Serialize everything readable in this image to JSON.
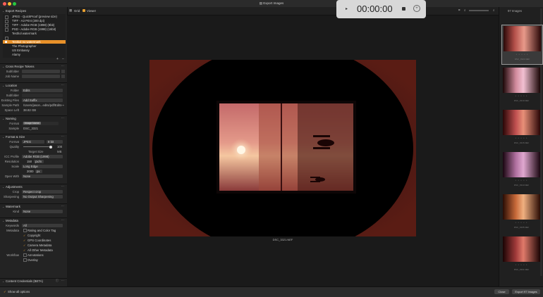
{
  "window": {
    "title": "Export Images"
  },
  "toolbar": {
    "grid_label": "Grid",
    "viewer_label": "Viewer"
  },
  "film_count": "97 Images",
  "recorder": {
    "time": "00:00:00"
  },
  "sidebar": {
    "export_recipes": {
      "title": "Export Recipes",
      "items": [
        "JPEG - QuickProof (preview size)",
        "TIFF - A3 Print (300 dpi)",
        "TIFF - Adobe RGB (1998) (8bit)",
        "PSD - Adobe RGB (1998) (16bit)",
        "Testhol watermark",
        "Testkol no watermark",
        "The Photographer",
        "US Embassy",
        "Alamy"
      ]
    },
    "cross_tokens": {
      "title": "Cross Recipe Tokens",
      "subfolder_label": "Subfolder",
      "jobname_label": "Job Name"
    },
    "location": {
      "title": "Location",
      "folder_label": "Folder",
      "folder_value": "Edits",
      "subfolder_label": "Subfolder",
      "existing_label": "Existing Files",
      "existing_value": "Add Suffix",
      "sample_label": "Sample Path",
      "sample_value": "/Users/jason...edits/pdf/Edits",
      "space_label": "Space Left",
      "space_value": "38.82 GB"
    },
    "naming": {
      "title": "Naming",
      "format_label": "Format",
      "format_value": "Image Name",
      "sample_label": "Sample",
      "sample_value": "DSC_3321"
    },
    "format": {
      "title": "Format & Size",
      "format_label": "Format",
      "format_value": "JPEG",
      "format_extra": "8 bit",
      "quality_label": "Quality",
      "quality_value": "100",
      "target_label": "Target Size",
      "target_value": "MB",
      "icc_label": "ICC Profile",
      "icc_value": "Adobe RGB (1998)",
      "res_label": "Resolution",
      "res_value": "150",
      "res_unit": "px/in",
      "scale_label": "Scale",
      "scale_value": "Long Edge",
      "long_value": "2000",
      "long_unit": "px",
      "open_label": "Open With",
      "open_value": "None"
    },
    "adjust": {
      "title": "Adjustments",
      "crop_label": "Crop",
      "crop_value": "Respect crop",
      "sharp_label": "Sharpening",
      "sharp_value": "No Output Sharpening"
    },
    "watermark": {
      "title": "Watermark",
      "kind_label": "Kind",
      "kind_value": "None"
    },
    "metadata": {
      "title": "Metadata",
      "keywords_label": "Keywords",
      "keywords_value": "All",
      "metadata_label": "Metadata",
      "items": [
        "Rating and Color Tag",
        "Copyright",
        "GPS Coordinates",
        "Camera Metadata",
        "All Other Metadata"
      ],
      "workflow_label": "Workflow",
      "workflow_items": [
        "Annotations",
        "Overlay"
      ]
    },
    "credentials": {
      "title": "Content Credentials (BETA)"
    }
  },
  "main": {
    "caption": "DSC_3321.NEF"
  },
  "filmstrip": [
    {
      "name": "DSC_3321.NEF",
      "stars": "• • • • •",
      "selected": true
    },
    {
      "name": "DSC_3319.NEF",
      "stars": "• • • • •",
      "selected": false
    },
    {
      "name": "DSC_3315.NEF",
      "stars": "• • • • •",
      "selected": false
    },
    {
      "name": "DSC_3310.NEF",
      "stars": "• • • • •",
      "selected": false
    },
    {
      "name": "DSC_3305.NEF",
      "stars": "• • • • •",
      "selected": false
    },
    {
      "name": "DSC_3301.NEF",
      "stars": "• • • • •",
      "selected": false
    }
  ],
  "bottom": {
    "show_all": "Show all options",
    "close": "Close",
    "export": "Export 97 Images"
  },
  "colors": {
    "accent": "#e8a030",
    "selected_row": "#e8912a"
  }
}
